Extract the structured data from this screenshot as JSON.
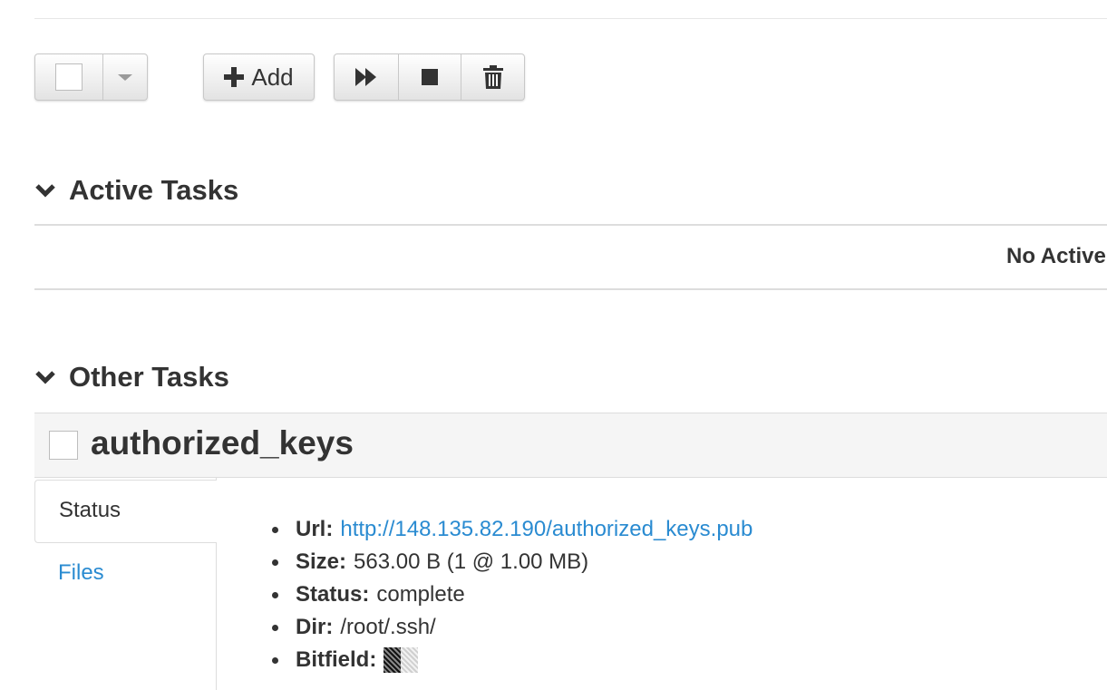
{
  "toolbar": {
    "add_label": "Add",
    "icons": {
      "select_caret": "caret-down-icon",
      "add": "plus-icon",
      "start": "fast-forward-icon",
      "stop": "stop-icon",
      "delete": "trash-icon"
    }
  },
  "active_section": {
    "title": "Active Tasks",
    "empty_text": "No Active"
  },
  "other_section": {
    "title": "Other Tasks",
    "task": {
      "name": "authorized_keys",
      "tabs": [
        {
          "label": "Status",
          "active": true
        },
        {
          "label": "Files",
          "active": false
        }
      ],
      "details": {
        "url_label": "Url:",
        "url_value": "http://148.135.82.190/authorized_keys.pub",
        "size_label": "Size:",
        "size_value": "563.00 B (1 @ 1.00 MB)",
        "status_label": "Status:",
        "status_value": "complete",
        "dir_label": "Dir:",
        "dir_value": "/root/.ssh/",
        "bitfield_label": "Bitfield:",
        "bitfield_pieces": [
          "full",
          "empty"
        ]
      }
    }
  },
  "colors": {
    "link": "#2a8bd1",
    "text": "#333333",
    "header_bg": "#f5f5f5",
    "border": "#dddddd"
  }
}
